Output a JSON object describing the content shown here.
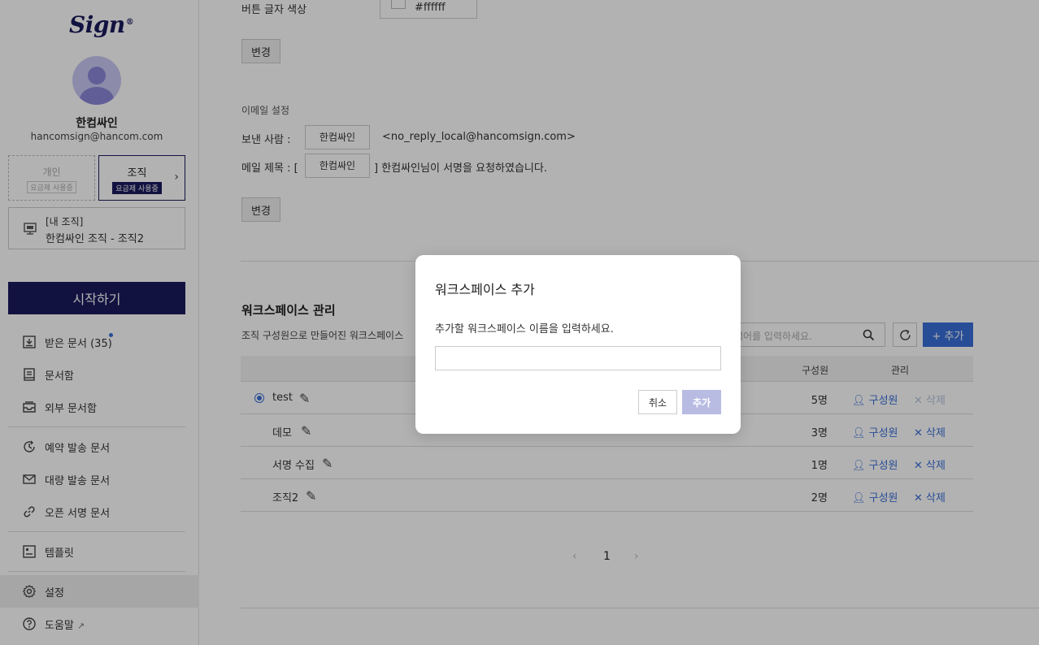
{
  "sidebar": {
    "logo": "Sign",
    "logo_mark": "®",
    "user_name": "한컴싸인",
    "user_email": "hancomsign@hancom.com",
    "plan_personal": {
      "label": "개인",
      "badge": "요금제 사용중"
    },
    "plan_org": {
      "label": "조직",
      "badge": "요금제 사용중"
    },
    "org": {
      "line1": "[내 조직]",
      "line2": "한컴싸인 조직 - 조직2"
    },
    "start_button": "시작하기",
    "nav": [
      {
        "label": "받은 문서 (35)",
        "icon": "inbox-icon"
      },
      {
        "label": "문서함",
        "icon": "document-box-icon"
      },
      {
        "label": "외부 문서함",
        "icon": "external-box-icon"
      },
      {
        "label": "예약 발송 문서",
        "icon": "clock-icon"
      },
      {
        "label": "대량 발송 문서",
        "icon": "mail-icon"
      },
      {
        "label": "오픈 서명 문서",
        "icon": "link-icon"
      },
      {
        "label": "템플릿",
        "icon": "template-icon"
      },
      {
        "label": "설정",
        "icon": "gear-icon"
      },
      {
        "label": "도움말",
        "icon": "help-icon"
      }
    ]
  },
  "main": {
    "button_text_color_label": "버튼 글자 색상",
    "button_text_color_value": "#ffffff",
    "change_label": "변경",
    "email_settings_title": "이메일 설정",
    "sender_label": "보낸 사람 :",
    "sender_name": "한컴싸인",
    "sender_email": "<no_reply_local@hancomsign.com>",
    "subject_label": "메일 제목 : [",
    "subject_name": "한컴싸인",
    "subject_suffix": "] 한컴싸인님이 서명을 요청하였습니다.",
    "workspace_title": "워크스페이스 관리",
    "workspace_desc": "조직 구성원으로 만들어진 워크스페이스",
    "search_placeholder": "색어를 입력하세요.",
    "add_button": "+ 추가",
    "table": {
      "col_members": "구성원",
      "col_manage": "관리",
      "members_link": "구성원",
      "delete_link": "삭제",
      "rows": [
        {
          "name": "test",
          "count": "5명",
          "selected": true
        },
        {
          "name": "데모",
          "count": "3명",
          "selected": false
        },
        {
          "name": "서명 수집",
          "count": "1명",
          "selected": false
        },
        {
          "name": "조직2",
          "count": "2명",
          "selected": false
        }
      ]
    },
    "pager": {
      "prev": "‹",
      "current": "1",
      "next": "›"
    }
  },
  "modal": {
    "title": "워크스페이스 추가",
    "description": "추가할 워크스페이스 이름을 입력하세요.",
    "input_value": "",
    "cancel": "취소",
    "confirm": "추가"
  },
  "colors": {
    "brand": "#1b1a5e",
    "accent": "#3a6fd8",
    "confirm_disabled": "#b8bbe2"
  }
}
